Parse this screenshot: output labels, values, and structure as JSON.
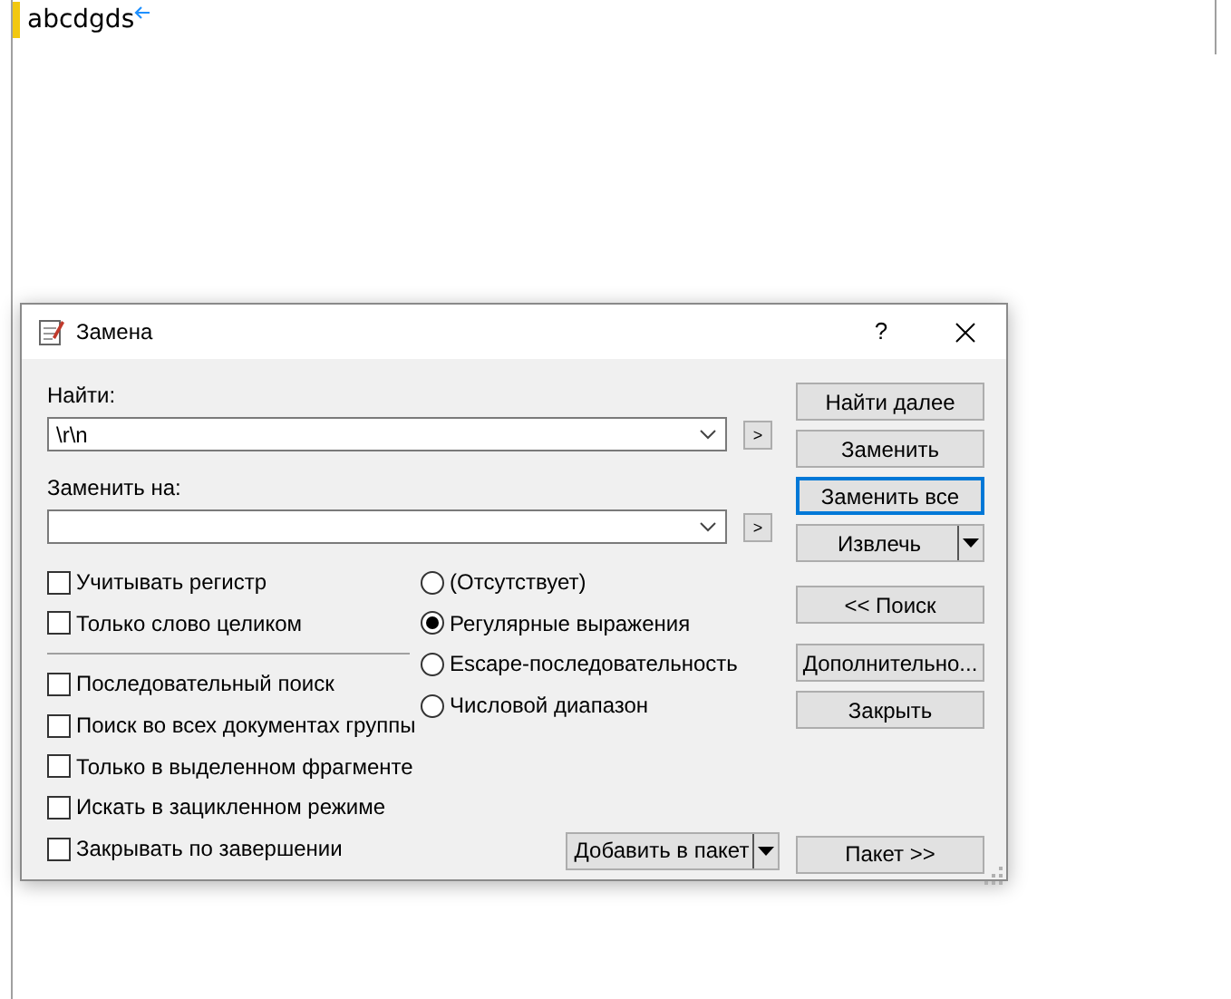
{
  "editor": {
    "text": "abcdgds"
  },
  "dialog": {
    "title": "Замена",
    "help": "?",
    "find": {
      "label": "Найти:",
      "value": "\\r\\n",
      "history_button": ">"
    },
    "replace": {
      "label": "Заменить на:",
      "history_button": ">"
    },
    "checkbox_groups": [
      [
        {
          "label": "Учитывать регистр",
          "checked": false
        },
        {
          "label": "Только слово целиком",
          "checked": false
        }
      ],
      [
        {
          "label": "Последовательный поиск",
          "checked": false
        },
        {
          "label": "Поиск во всех документах группы",
          "checked": false
        },
        {
          "label": "Только в выделенном фрагменте",
          "checked": false
        },
        {
          "label": "Искать в зацикленном режиме",
          "checked": false
        },
        {
          "label": "Закрывать по завершении",
          "checked": false
        }
      ]
    ],
    "modes": [
      {
        "label": "(Отсутствует)",
        "selected": false
      },
      {
        "label": "Регулярные выражения",
        "selected": true
      },
      {
        "label": "Escape-последовательность",
        "selected": false
      },
      {
        "label": "Числовой диапазон",
        "selected": false
      }
    ],
    "add_button": {
      "label": "Добавить в пакет",
      "kind": "split"
    },
    "button_groups": [
      [
        {
          "label": "Найти далее",
          "kind": "plain",
          "focused": false
        },
        {
          "label": "Заменить",
          "kind": "plain",
          "focused": false
        },
        {
          "label": "Заменить все",
          "kind": "plain",
          "focused": true
        },
        {
          "label": "Извлечь",
          "kind": "split",
          "focused": false
        }
      ],
      [
        {
          "label": "<< Поиск",
          "kind": "plain",
          "focused": false
        }
      ],
      [
        {
          "label": "Дополнительно...",
          "kind": "plain",
          "focused": false
        },
        {
          "label": "Закрыть",
          "kind": "plain",
          "focused": false
        }
      ]
    ],
    "batch_button": {
      "label": "Пакет >>",
      "focused": false
    }
  }
}
